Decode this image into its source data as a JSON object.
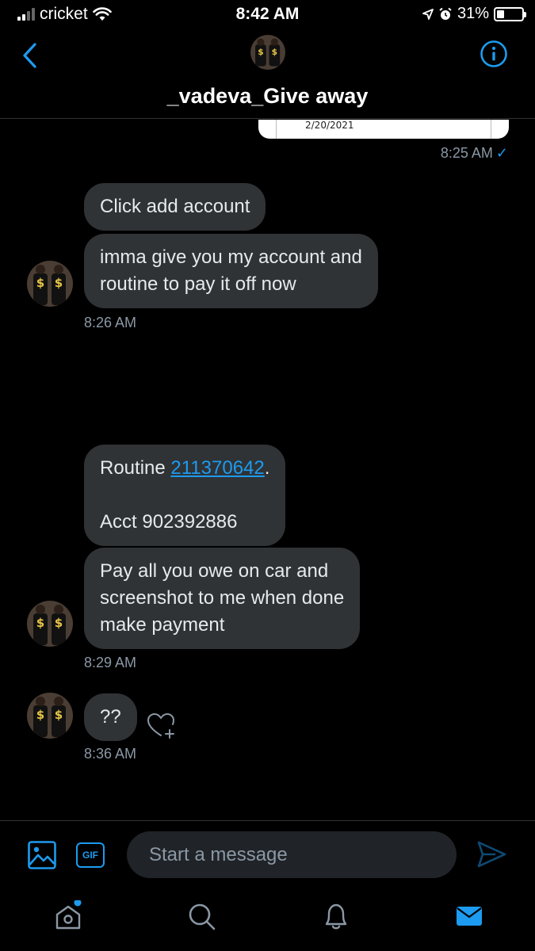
{
  "status_bar": {
    "carrier": "cricket",
    "time": "8:42 AM",
    "battery_percent": "31%",
    "battery_level": 0.31,
    "signal_bars": 2
  },
  "header": {
    "title": "_vadeva_Give away",
    "back_icon": "chevron-left-icon",
    "info_icon": "info-icon"
  },
  "conversation": {
    "sent_image": {
      "date_text": "2/20/2021",
      "time": "8:25 AM",
      "read_mark": "✓"
    },
    "groups": [
      {
        "messages": [
          "Click add account",
          "imma give you my account and\nroutine to pay it off now"
        ],
        "time": "8:26 AM"
      },
      {
        "messages": [
          {
            "prefix": "Routine ",
            "link": "211370642",
            "suffix": ".\n\nAcct 902392886"
          },
          "Pay all you owe on car and\nscreenshot to me when done\nmake payment"
        ],
        "time": "8:29 AM"
      },
      {
        "messages": [
          "??"
        ],
        "time": "8:36 AM"
      }
    ]
  },
  "composer": {
    "placeholder": "Start a message",
    "gif_label": "GIF"
  },
  "tabs": [
    "home-icon",
    "search-icon",
    "notifications-icon",
    "messages-icon"
  ],
  "colors": {
    "accent": "#1d9bf0",
    "bubble": "#2f3336",
    "background": "#000000",
    "muted": "#8b98a5"
  }
}
